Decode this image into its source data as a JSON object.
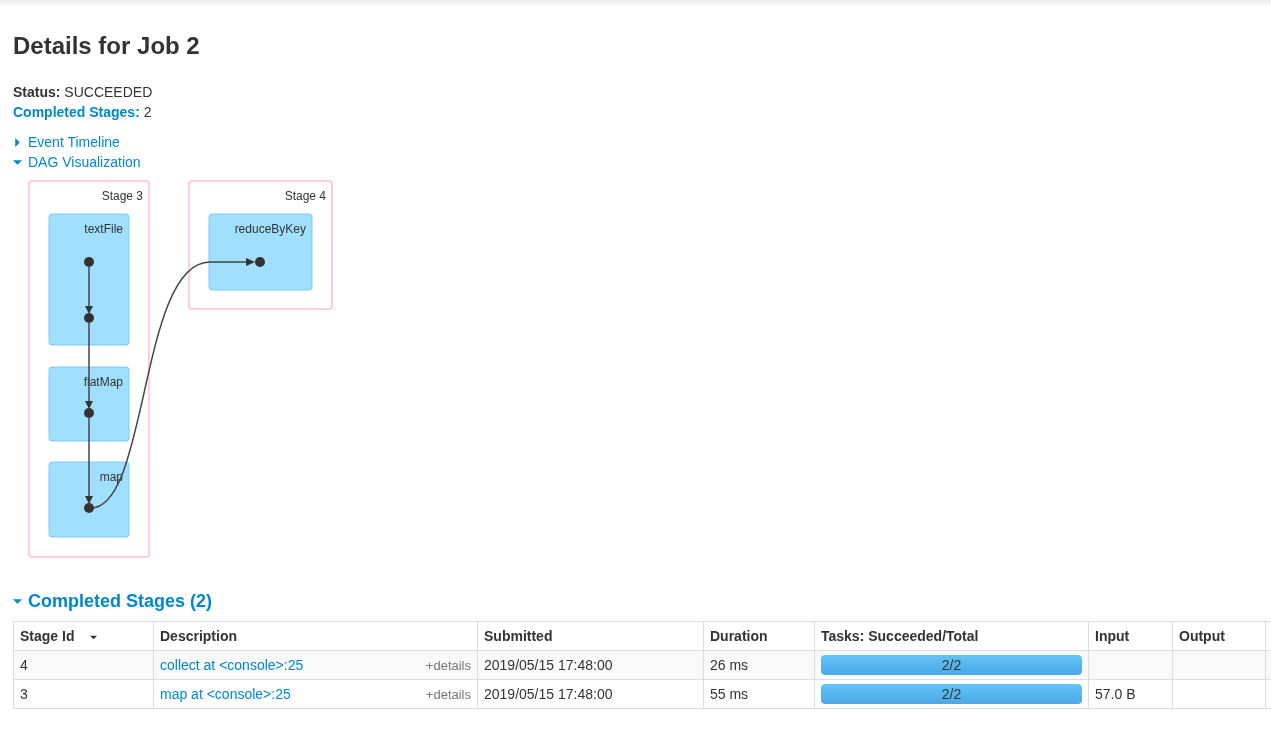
{
  "title": "Details for Job 2",
  "summary": [
    {
      "label": "Status:",
      "value": "SUCCEEDED",
      "kind": "plain"
    },
    {
      "label": "Completed Stages:",
      "value": "2",
      "kind": "link"
    }
  ],
  "toggles": [
    {
      "label": "Event Timeline",
      "expanded": false
    },
    {
      "label": "DAG Visualization",
      "expanded": true
    }
  ],
  "dag": {
    "stages": [
      {
        "label": "Stage 3",
        "nodes": [
          {
            "label": "textFile"
          },
          {
            "label": "flatMap"
          },
          {
            "label": "map"
          }
        ]
      },
      {
        "label": "Stage 4",
        "nodes": [
          {
            "label": "reduceByKey"
          }
        ]
      }
    ]
  },
  "section": {
    "title": "Completed Stages (2)",
    "expanded": true
  },
  "table": {
    "columns": [
      {
        "label": "Stage Id",
        "sorted": true
      },
      {
        "label": "Description",
        "sorted": false
      },
      {
        "label": "Submitted",
        "sorted": false
      },
      {
        "label": "Duration",
        "sorted": false
      },
      {
        "label": "Tasks: Succeeded/Total",
        "sorted": false
      },
      {
        "label": "Input",
        "sorted": false
      },
      {
        "label": "Output",
        "sorted": false
      }
    ],
    "rows": [
      {
        "id": "4",
        "description": "collect at <console>:25",
        "details": "+details",
        "submitted": "2019/05/15 17:48:00",
        "duration": "26 ms",
        "tasks": "2/2",
        "level": 1
      },
      {
        "id": "3",
        "description": "map at <console>:25",
        "details": "+details",
        "submitted": "2019/05/15 17:48:00",
        "duration": "55 ms",
        "tasks": "2/2",
        "level": 1,
        "input": "57.0 B"
      }
    ]
  }
}
